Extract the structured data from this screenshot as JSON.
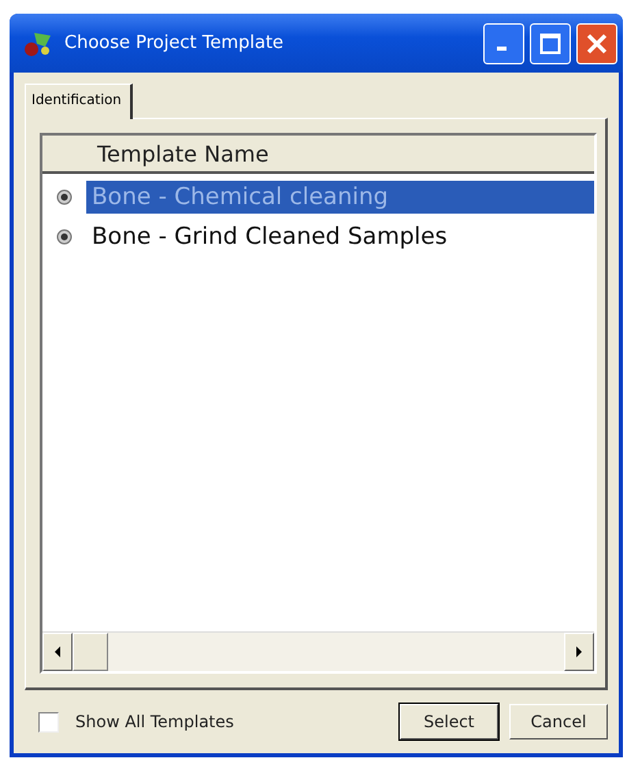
{
  "window": {
    "title": "Choose Project Template"
  },
  "tabs": [
    {
      "label": "Identification",
      "selected": true
    }
  ],
  "table": {
    "columns": [
      "Template Name"
    ],
    "rows": [
      {
        "name": "Bone - Chemical cleaning",
        "selected": true
      },
      {
        "name": "Bone - Grind Cleaned Samples",
        "selected": false
      }
    ]
  },
  "show_all": {
    "label": "Show All Templates",
    "checked": false
  },
  "buttons": [
    {
      "label": "Select",
      "default": true
    },
    {
      "label": "Cancel",
      "default": false
    }
  ]
}
